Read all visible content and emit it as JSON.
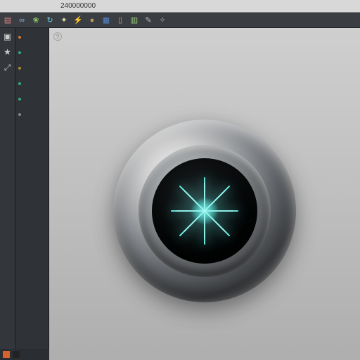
{
  "menubar": {
    "items": [
      "",
      "",
      ""
    ],
    "readout": "240000000"
  },
  "toolbar": {
    "icons": [
      {
        "name": "layers-icon",
        "glyph": "▤",
        "color": "#d88"
      },
      {
        "name": "link-icon",
        "glyph": "∞",
        "color": "#8ad"
      },
      {
        "name": "leaf-icon",
        "glyph": "❀",
        "color": "#8c6"
      },
      {
        "name": "refresh-icon",
        "glyph": "↻",
        "color": "#6cd"
      },
      {
        "name": "spark-icon",
        "glyph": "✦",
        "color": "#dda"
      },
      {
        "name": "bolt-icon",
        "glyph": "⚡",
        "color": "#dd8"
      },
      {
        "name": "circle-icon",
        "glyph": "●",
        "color": "#b95"
      },
      {
        "name": "palette-icon",
        "glyph": "▦",
        "color": "#58c"
      },
      {
        "name": "doc-icon",
        "glyph": "▯",
        "color": "#d96"
      },
      {
        "name": "patch-icon",
        "glyph": "▥",
        "color": "#9c7"
      },
      {
        "name": "brush-icon",
        "glyph": "✎",
        "color": "#bbb"
      },
      {
        "name": "wrench-icon",
        "glyph": "✧",
        "color": "#aaa"
      }
    ]
  },
  "toolstrip": {
    "items": [
      {
        "name": "cursor-icon",
        "glyph": "▣"
      },
      {
        "name": "star-icon",
        "glyph": "★"
      },
      {
        "name": "expand-icon",
        "glyph": "⤢"
      }
    ]
  },
  "leftpanel": {
    "items": [
      {
        "label": "",
        "color": "#c73"
      },
      {
        "label": "",
        "color": "#3a7"
      },
      {
        "label": "",
        "color": "#a83"
      },
      {
        "label": "",
        "color": "#3a7"
      },
      {
        "label": "",
        "color": "#3a7"
      },
      {
        "label": "",
        "color": "#888"
      }
    ]
  },
  "viewport": {
    "corner_label": "?"
  },
  "statusbar": {
    "swatches": [
      "#d8622c",
      "#222"
    ]
  }
}
